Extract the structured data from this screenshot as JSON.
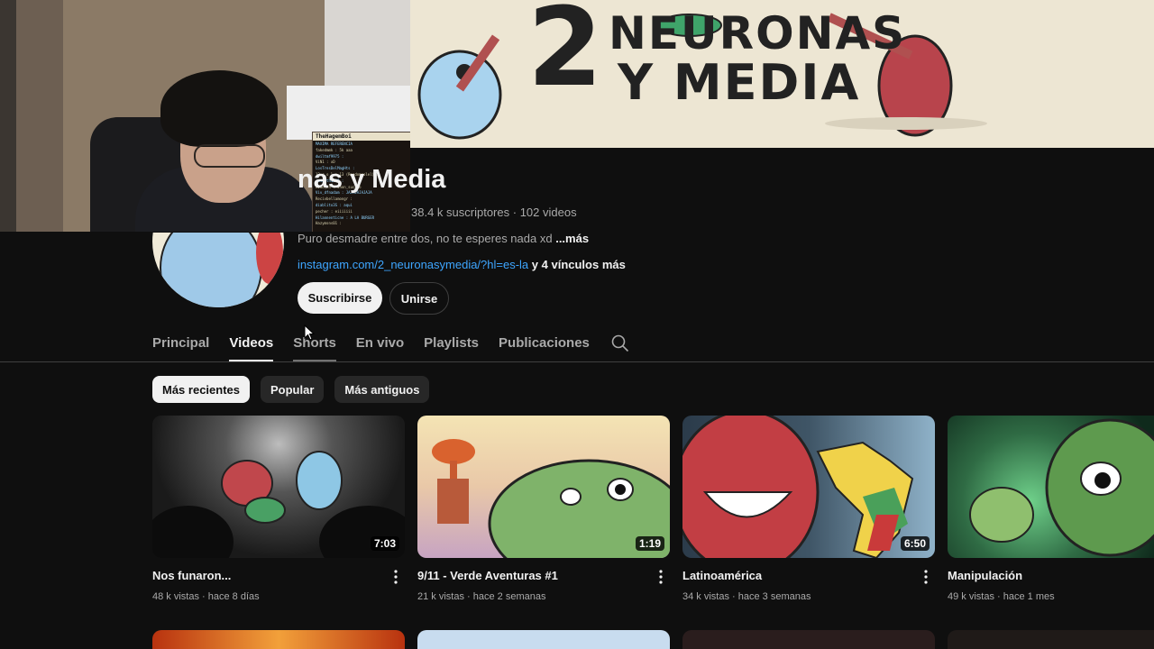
{
  "banner": {
    "line1": "2",
    "line2": "NEURONAS",
    "line3": "Y MEDIA"
  },
  "stream_chat": {
    "header": "TheHagemBoi",
    "messages": [
      "MAXIMA REFERENCIA",
      "fakedmmk : 5k  aaa",
      "dwiltmf9975 :",
      "ViN1 : xD",
      "LosTresDelMagHts :",
      "12 c o l o 13 (Randomgolel) :",
      "jaimeth1999 :",
      "kimo_hh : Jhon_sucaro",
      "Viv_dfnadam : JAJAJAJAJAJA",
      "Recivbellamongr :",
      "diablito3S : aqui",
      "pecher : eiiiiiii",
      "Hilannenticne : A LA BURGER",
      "Hazymons01 :"
    ]
  },
  "channel": {
    "name": "nas y Media",
    "subscribers": "38.4 k suscriptores",
    "videos_count": "102 videos",
    "separator": "·",
    "description": "Puro desmadre entre dos, no te esperes nada xd",
    "description_more": "...más",
    "link": "instagram.com/2_neuronasymedia/?hl=es-la",
    "links_more": "y 4 vínculos más",
    "subscribe_label": "Suscribirse",
    "join_label": "Unirse"
  },
  "tabs": [
    {
      "label": "Principal",
      "active": false
    },
    {
      "label": "Videos",
      "active": true
    },
    {
      "label": "Shorts",
      "active": false
    },
    {
      "label": "En vivo",
      "active": false
    },
    {
      "label": "Playlists",
      "active": false
    },
    {
      "label": "Publicaciones",
      "active": false
    }
  ],
  "chips": [
    {
      "label": "Más recientes",
      "active": true
    },
    {
      "label": "Popular",
      "active": false
    },
    {
      "label": "Más antiguos",
      "active": false
    }
  ],
  "videos": [
    {
      "title": "Nos funaron...",
      "views": "48 k vistas",
      "age": "hace 8 días",
      "duration": "7:03"
    },
    {
      "title": "9/11 - Verde Aventuras #1",
      "views": "21 k vistas",
      "age": "hace 2 semanas",
      "duration": "1:19"
    },
    {
      "title": "Latinoamérica",
      "views": "34 k vistas",
      "age": "hace 3 semanas",
      "duration": "6:50"
    },
    {
      "title": "Manipulación",
      "views": "49 k vistas",
      "age": "hace 1 mes",
      "duration": ""
    }
  ],
  "icons": {
    "search": "search-icon",
    "more": "more-vert-icon",
    "cursor": "mouse-cursor-icon"
  },
  "colors": {
    "background": "#0f0f0f",
    "link": "#3ea6ff",
    "text": "#f1f1f1",
    "secondary": "#aaaaaa"
  }
}
